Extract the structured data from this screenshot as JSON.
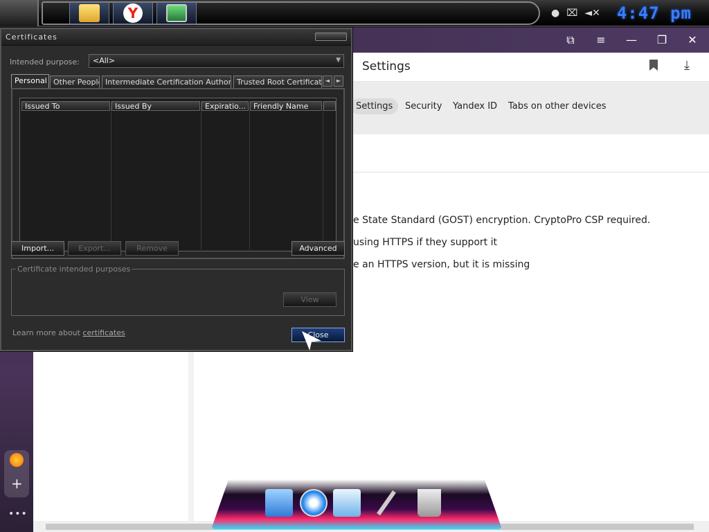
{
  "taskbar": {
    "apple_icon": "apple-icon",
    "apps": [
      {
        "name": "folder-icon"
      },
      {
        "name": "yandex-browser-icon",
        "glyph": "Y"
      },
      {
        "name": "monitor-icon"
      }
    ],
    "clock": "4:47 pm"
  },
  "browser": {
    "heading": "Settings",
    "tabs": [
      "Settings",
      "Security",
      "Yandex ID",
      "Tabs on other devices"
    ],
    "lines": [
      "e State Standard (GOST) encryption. CryptoPro CSP required.",
      "using HTTPS if they support it",
      "e an HTTPS version, but it is missing"
    ]
  },
  "dialog": {
    "title": "Certificates",
    "intended_purpose_label": "Intended purpose:",
    "intended_purpose_value": "<All>",
    "tabs": [
      "Personal",
      "Other People",
      "Intermediate Certification Authorities",
      "Trusted Root Certification"
    ],
    "columns": [
      "Issued To",
      "Issued By",
      "Expiratio...",
      "Friendly Name"
    ],
    "buttons": {
      "import": "Import...",
      "export": "Export...",
      "remove": "Remove",
      "advanced": "Advanced",
      "view": "View",
      "close": "Close"
    },
    "purposes_legend": "Certificate intended purposes",
    "learn_prefix": "Learn more about ",
    "learn_link": "certificates"
  },
  "colors": {
    "clock": "#3a7cff",
    "dialog_bg": "#2c2c2c",
    "close_button": "#1f3f7a"
  }
}
